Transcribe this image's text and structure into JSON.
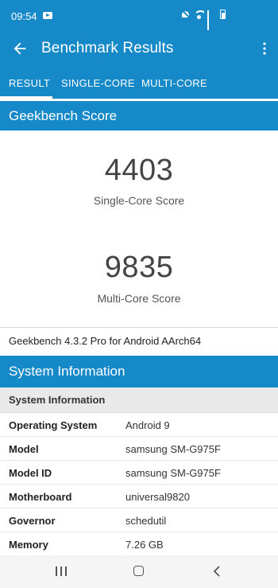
{
  "status_bar": {
    "time": "09:54",
    "icons": [
      "youtube-icon",
      "mute-icon",
      "wifi-icon",
      "signal-icon",
      "battery-icon"
    ]
  },
  "app_bar": {
    "title": "Benchmark Results",
    "back_icon": "arrow-left-icon",
    "menu_icon": "more-vert-icon"
  },
  "tabs": [
    {
      "label": "RESULT",
      "active": true
    },
    {
      "label": "SINGLE-CORE",
      "active": false
    },
    {
      "label": "MULTI-CORE",
      "active": false
    }
  ],
  "geekbench": {
    "header": "Geekbench Score",
    "single_core": {
      "value": "4403",
      "label": "Single-Core Score"
    },
    "multi_core": {
      "value": "9835",
      "label": "Multi-Core Score"
    },
    "version": "Geekbench 4.3.2 Pro for Android AArch64"
  },
  "system_info": {
    "header": "System Information",
    "subheader": "System Information",
    "rows": [
      {
        "key": "Operating System",
        "value": "Android 9"
      },
      {
        "key": "Model",
        "value": "samsung SM-G975F"
      },
      {
        "key": "Model ID",
        "value": "samsung SM-G975F"
      },
      {
        "key": "Motherboard",
        "value": "universal9820"
      },
      {
        "key": "Governor",
        "value": "schedutil"
      },
      {
        "key": "Memory",
        "value": "7.26 GB"
      }
    ]
  },
  "colors": {
    "primary": "#1689c9",
    "navbar": "#f5f5f5",
    "subheader_bg": "#e9e9e9"
  },
  "nav_bar": {
    "icons": [
      "recents-icon",
      "home-icon",
      "back-icon"
    ]
  }
}
